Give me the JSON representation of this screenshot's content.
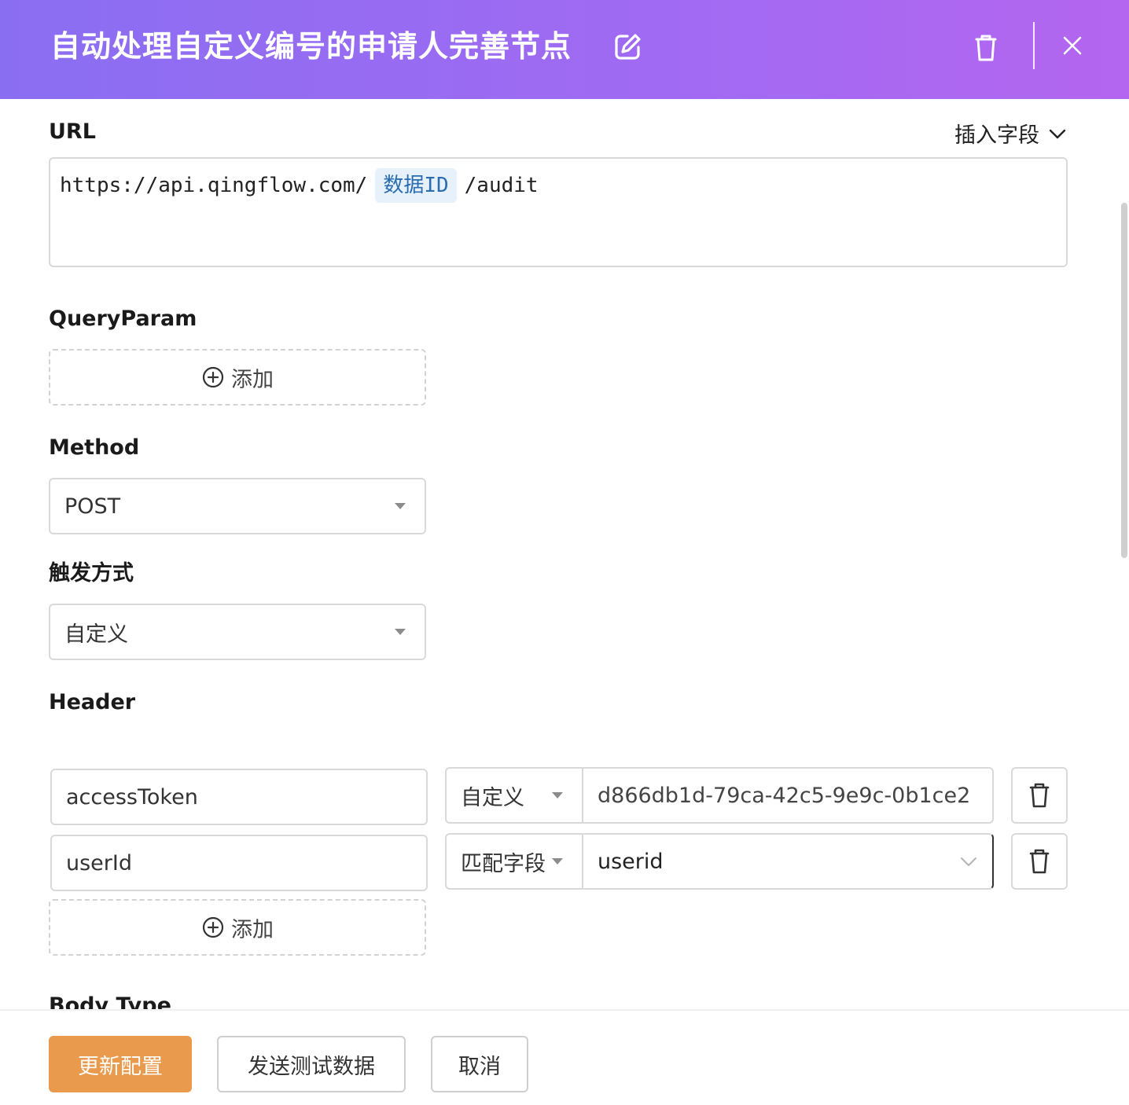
{
  "header": {
    "title": "自动处理自定义编号的申请人完善节点"
  },
  "url": {
    "label": "URL",
    "insert_field": "插入字段",
    "prefix": "https://api.qingflow.com/",
    "tag": "数据ID",
    "suffix": "/audit"
  },
  "query_param": {
    "label": "QueryParam",
    "add_label": "添加"
  },
  "method": {
    "label": "Method",
    "value": "POST"
  },
  "trigger": {
    "label": "触发方式",
    "value": "自定义"
  },
  "header_section": {
    "label": "Header",
    "add_label": "添加",
    "rows": [
      {
        "key": "accessToken",
        "type": "自定义",
        "value": "d866db1d-79ca-42c5-9e9c-0b1ce2"
      },
      {
        "key": "userId",
        "type": "匹配字段",
        "value": "userid"
      }
    ]
  },
  "body_type": {
    "label": "Body Type"
  },
  "footer": {
    "update": "更新配置",
    "send_test": "发送测试数据",
    "cancel": "取消"
  },
  "colors": {
    "header_gradient_start": "#8a6ef2",
    "header_gradient_end": "#b466f0",
    "primary_button": "#ea9a4c",
    "tag_bg": "#e6f1fb",
    "tag_text": "#2a6cb0"
  }
}
